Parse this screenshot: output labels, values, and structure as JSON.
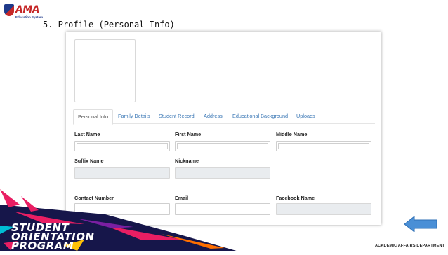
{
  "logo": {
    "brand": "AMA",
    "subtitle": "Education System"
  },
  "slide_title": "5. Profile (Personal Info)",
  "tabs": [
    {
      "label": "Personal Info",
      "active": true
    },
    {
      "label": "Family Details",
      "active": false
    },
    {
      "label": "Student Record",
      "active": false
    },
    {
      "label": "Address",
      "active": false
    },
    {
      "label": "Educational Background",
      "active": false
    },
    {
      "label": "Uploads",
      "active": false
    }
  ],
  "fields": {
    "last_name": "Last Name",
    "first_name": "First Name",
    "middle_name": "Middle Name",
    "suffix_name": "Suffix Name",
    "nickname": "Nickname",
    "contact_number": "Contact Number",
    "email": "Email",
    "facebook_name": "Facebook Name"
  },
  "banner": {
    "line1": "STUDENT",
    "line2": "ORIENTATION",
    "line3": "PROGRAM"
  },
  "footer": {
    "department": "ACADEMIC AFFAIRS DEPARTMENT"
  },
  "colors": {
    "accent_red": "#c62828",
    "tab_blue": "#3a77b5",
    "navy": "#16164a",
    "magenta": "#e91e63",
    "arrow_blue": "#4a8fd6"
  }
}
